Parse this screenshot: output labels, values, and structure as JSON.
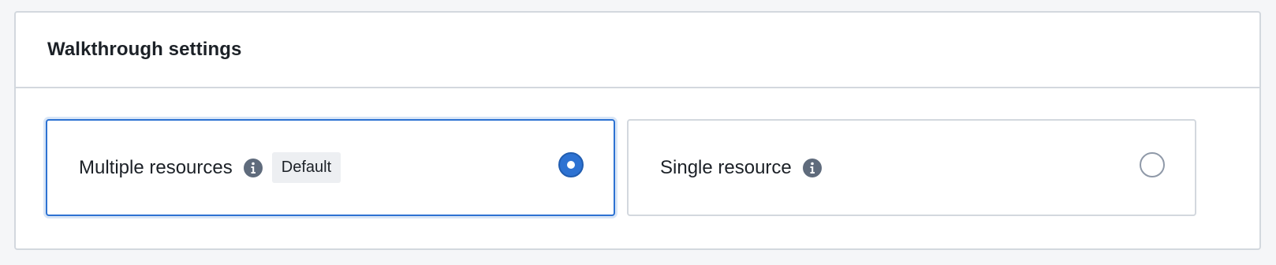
{
  "panel": {
    "title": "Walkthrough settings"
  },
  "options": [
    {
      "label": "Multiple resources",
      "badge": "Default",
      "selected": true,
      "icon": "info-icon"
    },
    {
      "label": "Single resource",
      "selected": false,
      "icon": "info-icon"
    }
  ],
  "colors": {
    "accent": "#2d72d2",
    "border": "#d3d8de",
    "icon": "#5f6b7c",
    "badge_bg": "#edeff2"
  }
}
